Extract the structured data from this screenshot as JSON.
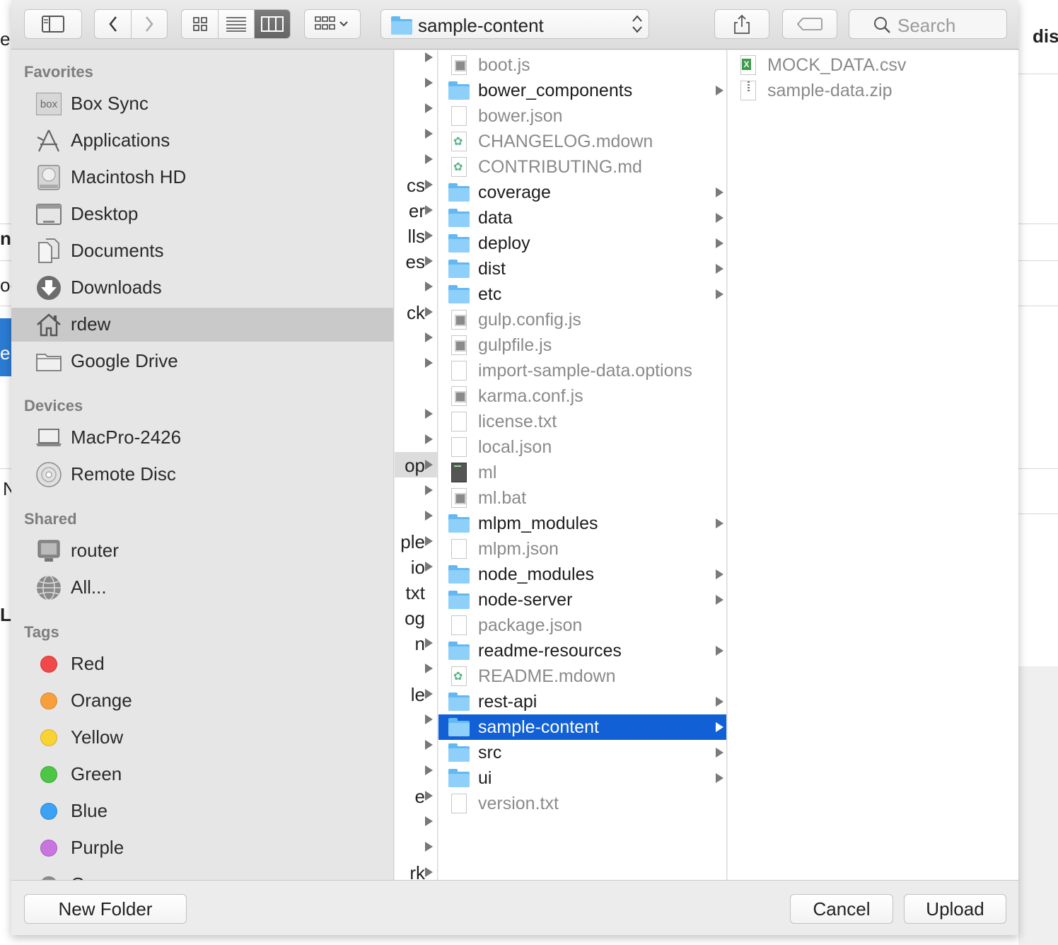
{
  "background": {
    "fragments": [
      "e",
      "ne",
      "o-",
      "e",
      "N",
      "L",
      "dis"
    ]
  },
  "toolbar": {
    "path_label": "sample-content",
    "search_placeholder": "Search"
  },
  "sidebar": {
    "favorites_header": "Favorites",
    "favorites": [
      {
        "label": "Box Sync",
        "icon": "box-icon"
      },
      {
        "label": "Applications",
        "icon": "applications-icon"
      },
      {
        "label": "Macintosh HD",
        "icon": "hard-drive-icon"
      },
      {
        "label": "Desktop",
        "icon": "desktop-icon"
      },
      {
        "label": "Documents",
        "icon": "documents-icon"
      },
      {
        "label": "Downloads",
        "icon": "downloads-icon"
      },
      {
        "label": "rdew",
        "icon": "home-icon",
        "selected": true
      },
      {
        "label": "Google Drive",
        "icon": "folder-icon"
      }
    ],
    "devices_header": "Devices",
    "devices": [
      {
        "label": "MacPro-2426",
        "icon": "laptop-icon"
      },
      {
        "label": "Remote Disc",
        "icon": "disc-icon"
      }
    ],
    "shared_header": "Shared",
    "shared": [
      {
        "label": "router",
        "icon": "monitor-icon"
      },
      {
        "label": "All...",
        "icon": "network-icon"
      }
    ],
    "tags_header": "Tags",
    "tags": [
      {
        "label": "Red",
        "color": "#f0494a"
      },
      {
        "label": "Orange",
        "color": "#f7a03b"
      },
      {
        "label": "Yellow",
        "color": "#f9d235"
      },
      {
        "label": "Green",
        "color": "#4dc646"
      },
      {
        "label": "Blue",
        "color": "#3da2f4"
      },
      {
        "label": "Purple",
        "color": "#c875e0"
      },
      {
        "label": "G",
        "color": "#8e8e8e"
      }
    ]
  },
  "column1": {
    "rows": [
      {
        "text": "",
        "arrow": true
      },
      {
        "text": "",
        "arrow": true
      },
      {
        "text": "",
        "arrow": true
      },
      {
        "text": "",
        "arrow": true
      },
      {
        "text": "",
        "arrow": true
      },
      {
        "text": "cs",
        "arrow": true
      },
      {
        "text": "er",
        "arrow": true
      },
      {
        "text": "lls",
        "arrow": true
      },
      {
        "text": "es",
        "arrow": true
      },
      {
        "text": "",
        "arrow": true
      },
      {
        "text": "ck",
        "arrow": true
      },
      {
        "text": "",
        "arrow": true
      },
      {
        "text": "",
        "arrow": true
      },
      {
        "text": "",
        "arrow": false
      },
      {
        "text": "",
        "arrow": true
      },
      {
        "text": "",
        "arrow": true
      },
      {
        "text": "op",
        "arrow": true,
        "selected": true
      },
      {
        "text": "",
        "arrow": true
      },
      {
        "text": "",
        "arrow": true
      },
      {
        "text": "ple",
        "arrow": true
      },
      {
        "text": "io",
        "arrow": true
      },
      {
        "text": "txt",
        "arrow": false
      },
      {
        "text": "og",
        "arrow": false
      },
      {
        "text": "n",
        "arrow": true
      },
      {
        "text": "",
        "arrow": true
      },
      {
        "text": "le",
        "arrow": true
      },
      {
        "text": "",
        "arrow": true
      },
      {
        "text": "",
        "arrow": true
      },
      {
        "text": "",
        "arrow": true
      },
      {
        "text": "e",
        "arrow": true
      },
      {
        "text": "",
        "arrow": true
      },
      {
        "text": "",
        "arrow": true
      },
      {
        "text": "rk",
        "arrow": true
      }
    ]
  },
  "column2": {
    "rows": [
      {
        "name": "boot.js",
        "kind": "script"
      },
      {
        "name": "bower_components",
        "kind": "folder"
      },
      {
        "name": "bower.json",
        "kind": "blank"
      },
      {
        "name": "CHANGELOG.mdown",
        "kind": "md"
      },
      {
        "name": "CONTRIBUTING.md",
        "kind": "md"
      },
      {
        "name": "coverage",
        "kind": "folder"
      },
      {
        "name": "data",
        "kind": "folder"
      },
      {
        "name": "deploy",
        "kind": "folder"
      },
      {
        "name": "dist",
        "kind": "folder"
      },
      {
        "name": "etc",
        "kind": "folder"
      },
      {
        "name": "gulp.config.js",
        "kind": "script"
      },
      {
        "name": "gulpfile.js",
        "kind": "script"
      },
      {
        "name": "import-sample-data.options",
        "kind": "blank"
      },
      {
        "name": "karma.conf.js",
        "kind": "script"
      },
      {
        "name": "license.txt",
        "kind": "blank"
      },
      {
        "name": "local.json",
        "kind": "blank"
      },
      {
        "name": "ml",
        "kind": "term"
      },
      {
        "name": "ml.bat",
        "kind": "script"
      },
      {
        "name": "mlpm_modules",
        "kind": "folder"
      },
      {
        "name": "mlpm.json",
        "kind": "blank"
      },
      {
        "name": "node_modules",
        "kind": "folder"
      },
      {
        "name": "node-server",
        "kind": "folder"
      },
      {
        "name": "package.json",
        "kind": "blank"
      },
      {
        "name": "readme-resources",
        "kind": "folder"
      },
      {
        "name": "README.mdown",
        "kind": "md"
      },
      {
        "name": "rest-api",
        "kind": "folder"
      },
      {
        "name": "sample-content",
        "kind": "folder",
        "selected": true
      },
      {
        "name": "src",
        "kind": "folder"
      },
      {
        "name": "ui",
        "kind": "folder"
      },
      {
        "name": "version.txt",
        "kind": "blank"
      }
    ]
  },
  "column3": {
    "rows": [
      {
        "name": "MOCK_DATA.csv",
        "kind": "csv"
      },
      {
        "name": "sample-data.zip",
        "kind": "zip"
      }
    ]
  },
  "buttons": {
    "new_folder": "New Folder",
    "cancel": "Cancel",
    "upload": "Upload"
  }
}
